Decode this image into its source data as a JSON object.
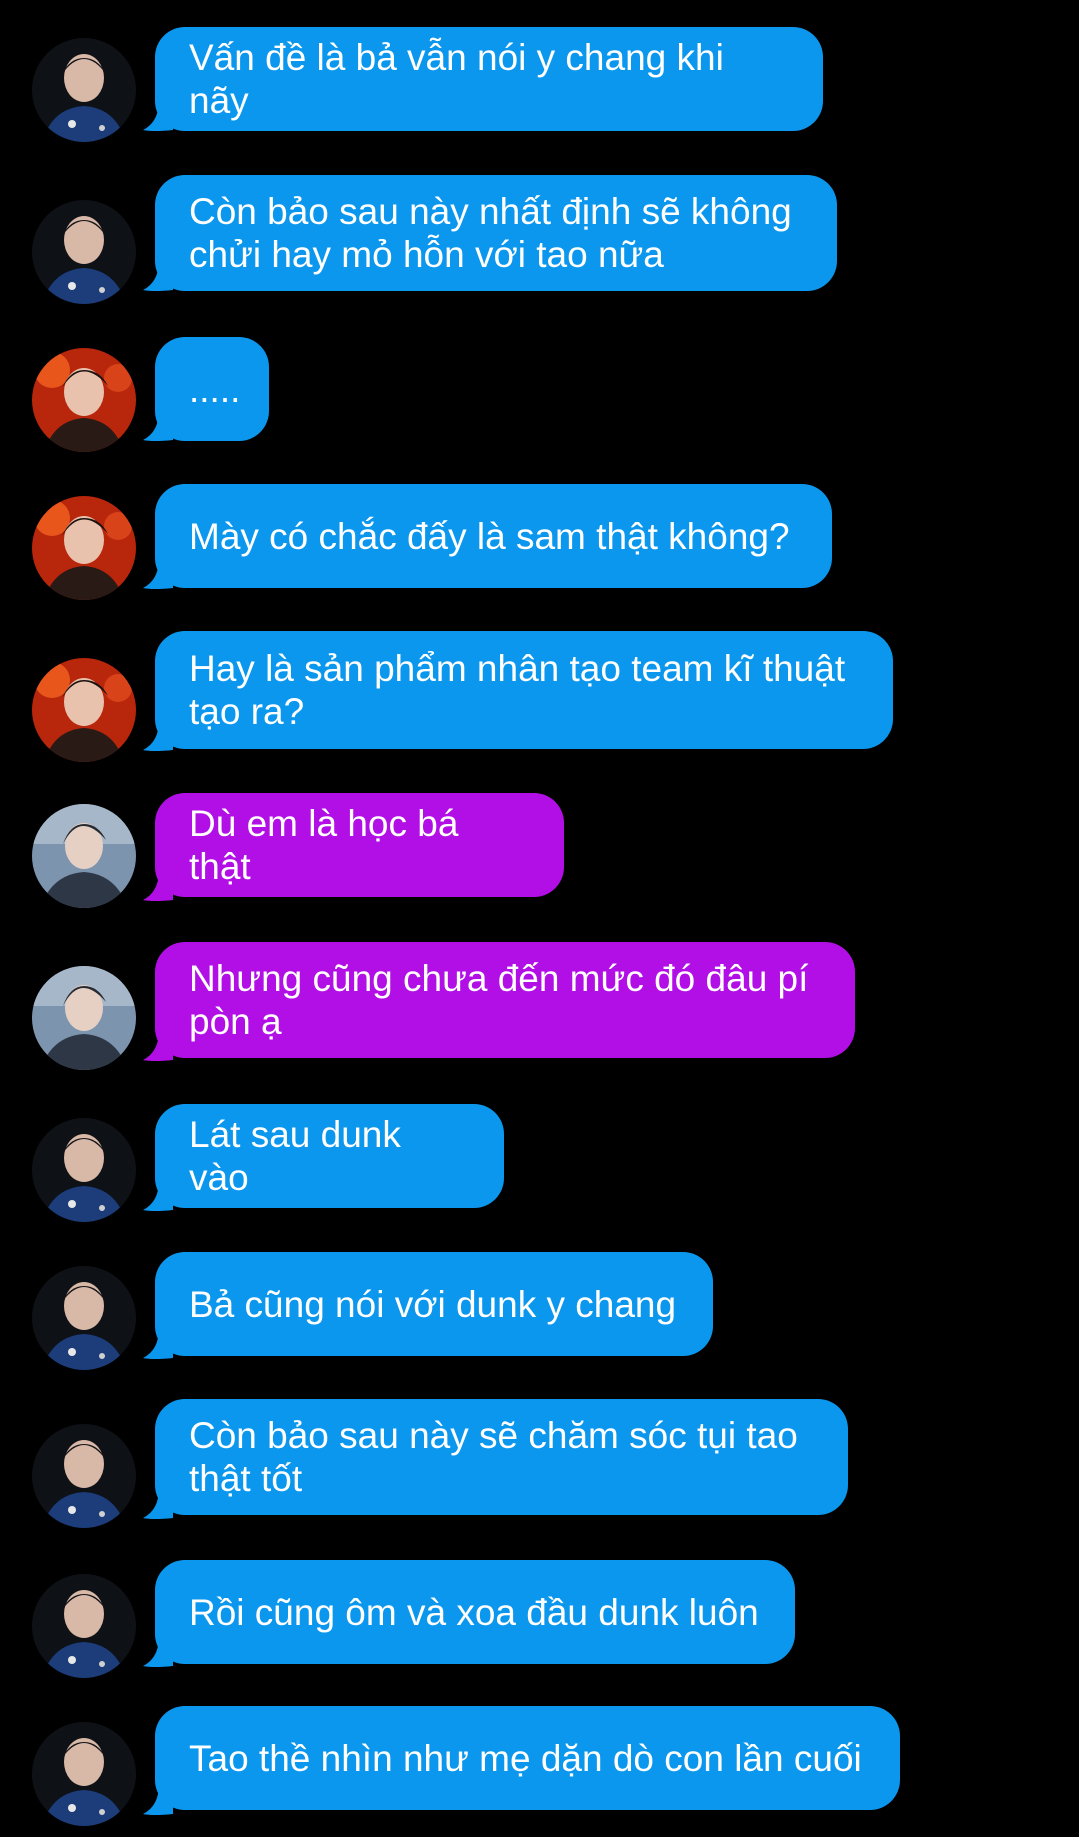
{
  "colors": {
    "background": "#000000",
    "bubble_blue": "#0b97ee",
    "bubble_purple": "#b20ee6",
    "text": "#ffffff"
  },
  "messages": [
    {
      "avatar": "avatar-dark-blue",
      "bubble": "blue",
      "text": "Vấn đề là bả vẫn nói y chang khi nãy"
    },
    {
      "avatar": "avatar-dark-blue",
      "bubble": "blue",
      "text": "Còn bảo sau này nhất định sẽ không chửi hay mỏ hỗn với tao nữa"
    },
    {
      "avatar": "avatar-red-orange",
      "bubble": "blue",
      "text": "....."
    },
    {
      "avatar": "avatar-red-orange",
      "bubble": "blue",
      "text": "Mày có chắc đấy là sam thật không?"
    },
    {
      "avatar": "avatar-red-orange",
      "bubble": "blue",
      "text": "Hay là sản phẩm nhân tạo team kĩ thuật tạo ra?"
    },
    {
      "avatar": "avatar-grey-blue",
      "bubble": "purple",
      "text": "Dù em là học bá thật"
    },
    {
      "avatar": "avatar-grey-blue",
      "bubble": "purple",
      "text": "Nhưng cũng chưa đến mức đó đâu pí pòn ạ"
    },
    {
      "avatar": "avatar-dark-blue",
      "bubble": "blue",
      "text": "Lát sau dunk vào"
    },
    {
      "avatar": "avatar-dark-blue",
      "bubble": "blue",
      "text": "Bả cũng nói với dunk y chang"
    },
    {
      "avatar": "avatar-dark-blue",
      "bubble": "blue",
      "text": "Còn bảo sau này sẽ chăm sóc tụi tao thật tốt"
    },
    {
      "avatar": "avatar-dark-blue",
      "bubble": "blue",
      "text": "Rồi cũng ôm và xoa đầu dunk luôn"
    },
    {
      "avatar": "avatar-dark-blue",
      "bubble": "blue",
      "text": "Tao thề nhìn như mẹ dặn dò con lần cuối"
    }
  ]
}
